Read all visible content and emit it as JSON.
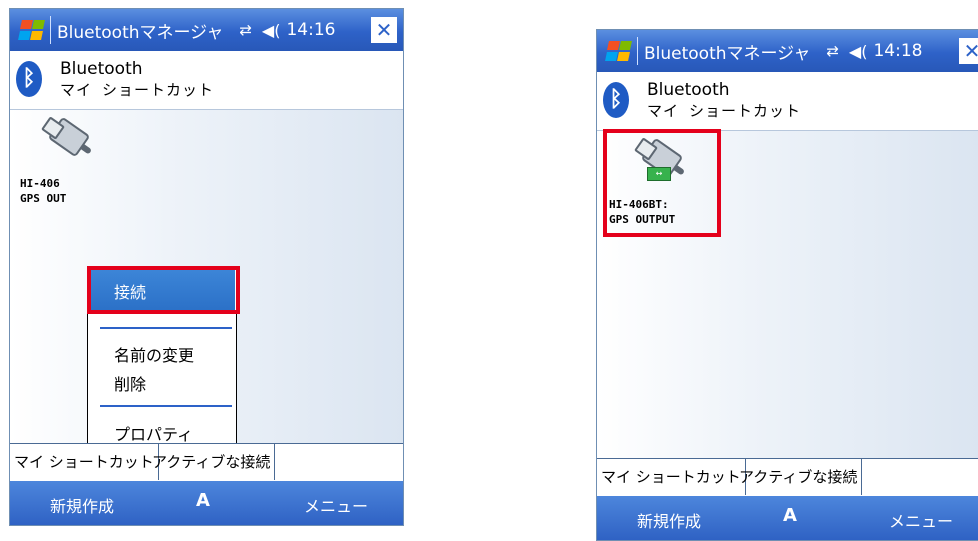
{
  "screens": [
    {
      "title_app": "Bluetoothマネージャ",
      "time": "14:16",
      "header_title": "Bluetooth",
      "header_subtitle": "マイ ショートカット",
      "device_label": "HI-406\nGPS OUT",
      "context_menu": [
        "接続",
        "名前の変更",
        "削除",
        "プロパティ"
      ],
      "selected_item": "接続",
      "tabs": [
        "マイ ショートカット",
        "アクティブな接続"
      ],
      "softkeys": {
        "left": "新規作成",
        "middle": "A",
        "right": "メニュー"
      }
    },
    {
      "title_app": "Bluetoothマネージャ",
      "time": "14:18",
      "header_title": "Bluetooth",
      "header_subtitle": "マイ ショートカット",
      "device_label": "HI-406BT:\nGPS OUTPUT",
      "tabs": [
        "マイ ショートカット",
        "アクティブな接続"
      ],
      "softkeys": {
        "left": "新規作成",
        "middle": "A",
        "right": "メニュー"
      }
    }
  ],
  "icons": {
    "start": "windows-flag-icon",
    "connectivity": "connectivity-icon",
    "volume": "volume-icon",
    "close": "close-icon",
    "bluetooth": "bluetooth-icon",
    "device": "serial-port-device-icon"
  },
  "colors": {
    "titlebar": "#2e62c8",
    "highlight": "#e4001b",
    "selection": "#2a6fc6"
  }
}
